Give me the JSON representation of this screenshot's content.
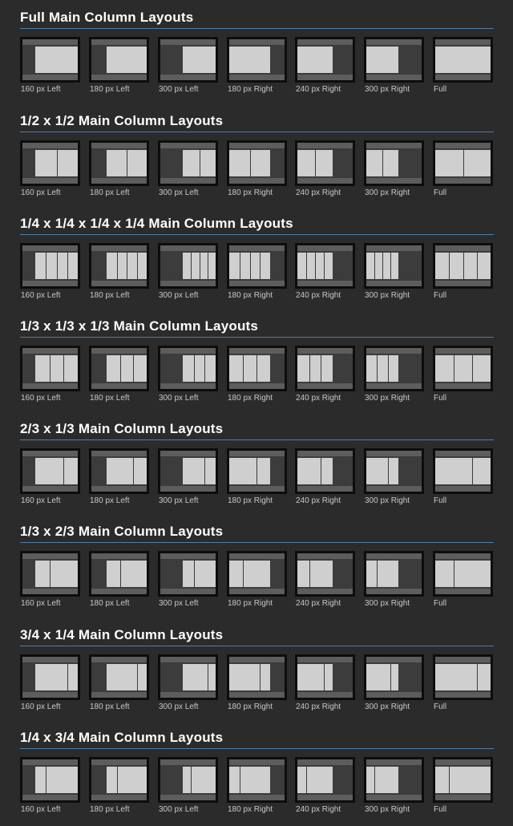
{
  "sections": [
    {
      "title": "Full Main Column Layouts",
      "layout": "full"
    },
    {
      "title": "1/2 x 1/2 Main Column Layouts",
      "layout": "half"
    },
    {
      "title": "1/4 x 1/4 x 1/4 x 1/4 Main Column Layouts",
      "layout": "quarters"
    },
    {
      "title": "1/3 x 1/3 x 1/3 Main Column Layouts",
      "layout": "thirds"
    },
    {
      "title": "2/3 x 1/3 Main Column Layouts",
      "layout": "two-third-one-third"
    },
    {
      "title": "1/3 x 2/3 Main Column Layouts",
      "layout": "one-third-two-third"
    },
    {
      "title": "3/4 x 1/4 Main Column Layouts",
      "layout": "three-quarter-one-quarter"
    },
    {
      "title": "1/4 x 3/4 Main Column Layouts",
      "layout": "one-quarter-three-quarter"
    }
  ],
  "variants": [
    "160 px Left",
    "180 px Left",
    "300 px Left",
    "180 px Right",
    "240 px Right",
    "300 px Right",
    "Full"
  ],
  "colors": {
    "background": "#2b2b2b",
    "title": "#ffffff",
    "rule": "#4d7fa8",
    "caption": "#c8c8c8",
    "thumb_border": "#0d0d0d",
    "thumb_body": "#3c3c3c",
    "thumb_band": "#5d5d5d",
    "thumb_column": "#cfcfcf"
  }
}
